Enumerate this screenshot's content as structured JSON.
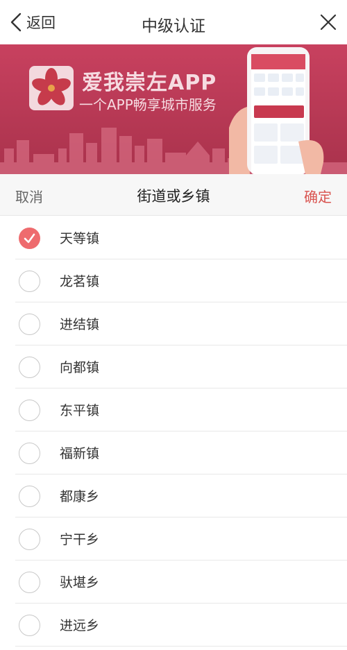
{
  "nav": {
    "back_label": "返回",
    "title": "中级认证"
  },
  "banner": {
    "app_title": "爱我崇左APP",
    "app_subtitle": "一个APP畅享城市服务",
    "bg_color": "#b83c56"
  },
  "picker": {
    "cancel_label": "取消",
    "title": "街道或乡镇",
    "confirm_label": "确定",
    "accent_color": "#ee6b6e"
  },
  "options": [
    {
      "label": "天等镇",
      "checked": true
    },
    {
      "label": "龙茗镇",
      "checked": false
    },
    {
      "label": "进结镇",
      "checked": false
    },
    {
      "label": "向都镇",
      "checked": false
    },
    {
      "label": "东平镇",
      "checked": false
    },
    {
      "label": "福新镇",
      "checked": false
    },
    {
      "label": "都康乡",
      "checked": false
    },
    {
      "label": "宁干乡",
      "checked": false
    },
    {
      "label": "驮堪乡",
      "checked": false
    },
    {
      "label": "进远乡",
      "checked": false
    }
  ]
}
